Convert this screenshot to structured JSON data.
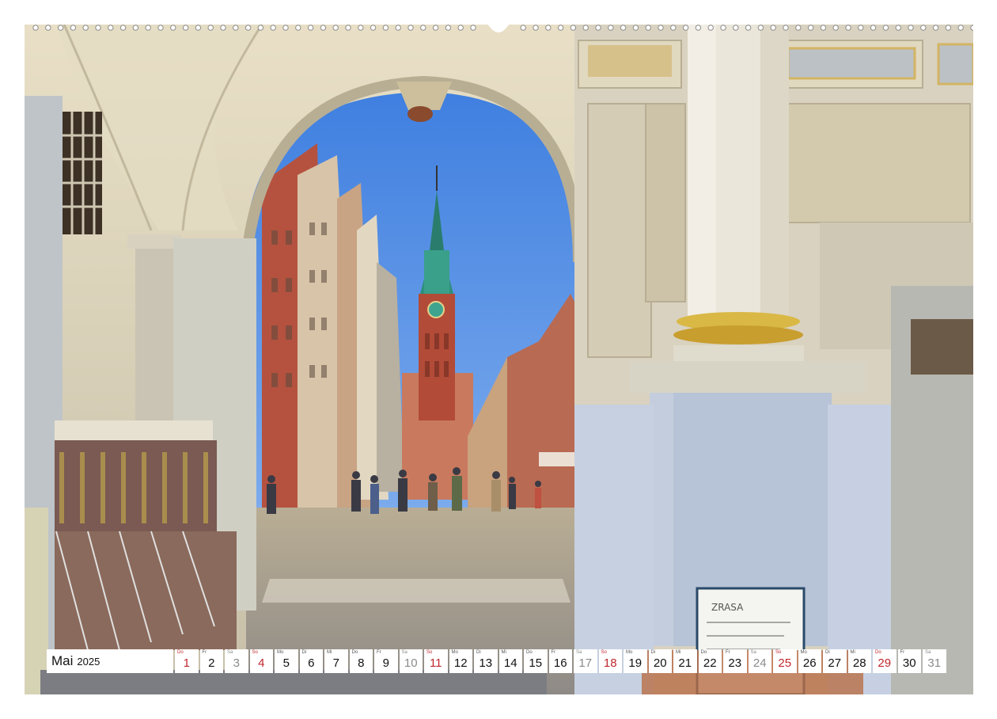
{
  "calendar": {
    "month": "Mai",
    "year": "2025",
    "days": [
      {
        "dn": "Do",
        "num": "1",
        "type": "holiday"
      },
      {
        "dn": "Fr",
        "num": "2",
        "type": "weekday"
      },
      {
        "dn": "Sa",
        "num": "3",
        "type": "saturday"
      },
      {
        "dn": "So",
        "num": "4",
        "type": "sunday"
      },
      {
        "dn": "Mo",
        "num": "5",
        "type": "weekday"
      },
      {
        "dn": "Di",
        "num": "6",
        "type": "weekday"
      },
      {
        "dn": "Mi",
        "num": "7",
        "type": "weekday"
      },
      {
        "dn": "Do",
        "num": "8",
        "type": "weekday"
      },
      {
        "dn": "Fr",
        "num": "9",
        "type": "weekday"
      },
      {
        "dn": "Sa",
        "num": "10",
        "type": "saturday"
      },
      {
        "dn": "So",
        "num": "11",
        "type": "sunday"
      },
      {
        "dn": "Mo",
        "num": "12",
        "type": "weekday"
      },
      {
        "dn": "Di",
        "num": "13",
        "type": "weekday"
      },
      {
        "dn": "Mi",
        "num": "14",
        "type": "weekday"
      },
      {
        "dn": "Do",
        "num": "15",
        "type": "weekday"
      },
      {
        "dn": "Fr",
        "num": "16",
        "type": "weekday"
      },
      {
        "dn": "Sa",
        "num": "17",
        "type": "saturday"
      },
      {
        "dn": "So",
        "num": "18",
        "type": "sunday"
      },
      {
        "dn": "Mo",
        "num": "19",
        "type": "weekday"
      },
      {
        "dn": "Di",
        "num": "20",
        "type": "weekday"
      },
      {
        "dn": "Mi",
        "num": "21",
        "type": "weekday"
      },
      {
        "dn": "Do",
        "num": "22",
        "type": "weekday"
      },
      {
        "dn": "Fr",
        "num": "23",
        "type": "weekday"
      },
      {
        "dn": "Sa",
        "num": "24",
        "type": "saturday"
      },
      {
        "dn": "So",
        "num": "25",
        "type": "sunday"
      },
      {
        "dn": "Mo",
        "num": "26",
        "type": "weekday"
      },
      {
        "dn": "Di",
        "num": "27",
        "type": "weekday"
      },
      {
        "dn": "Mi",
        "num": "28",
        "type": "weekday"
      },
      {
        "dn": "Do",
        "num": "29",
        "type": "holiday"
      },
      {
        "dn": "Fr",
        "num": "30",
        "type": "weekday"
      },
      {
        "dn": "Sa",
        "num": "31",
        "type": "saturday"
      }
    ]
  },
  "photo": {
    "subject": "gdansk-long-lane-through-arch",
    "sign_text": "ZRASA"
  },
  "colors": {
    "sky": "#4f8ee8",
    "stone": "#d8d1bf",
    "sunday_red": "#c0272d",
    "binding_gray": "#8d8d8d"
  }
}
